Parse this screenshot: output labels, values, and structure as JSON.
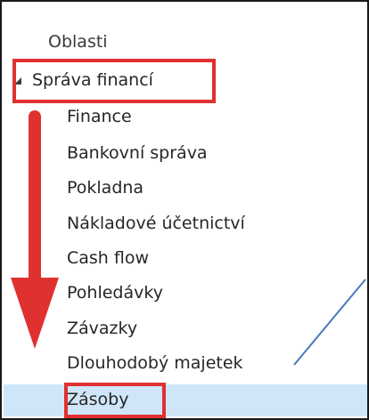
{
  "navigation": {
    "header": "Oblasti",
    "group": {
      "label": "Správa financí",
      "expanded": true
    },
    "items": [
      {
        "label": "Finance"
      },
      {
        "label": "Bankovní správa"
      },
      {
        "label": "Pokladna"
      },
      {
        "label": "Nákladové účetnictví"
      },
      {
        "label": "Cash flow"
      },
      {
        "label": "Pohledávky"
      },
      {
        "label": "Závazky"
      },
      {
        "label": "Dlouhodobý majetek"
      },
      {
        "label": "Zásoby",
        "selected": true
      }
    ]
  },
  "colors": {
    "annotation_red": "#e03131",
    "selection_background": "#cfe6f8",
    "leader_line": "#4a78b8"
  }
}
